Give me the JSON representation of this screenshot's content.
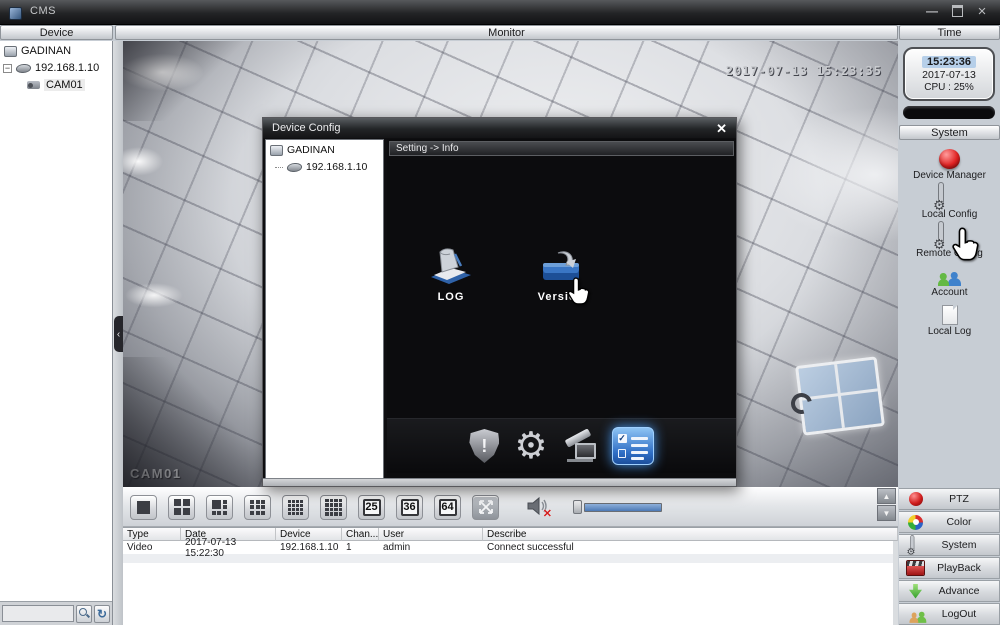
{
  "window": {
    "title": "CMS"
  },
  "glyphs": {
    "minimize": "—",
    "close": "×",
    "dialog_close": "✕",
    "collapse_left": "‹",
    "tree_collapse": "−",
    "refresh": "↻",
    "scroll_up": "▲",
    "scroll_down": "▼",
    "gear": "⚙",
    "mute_x": "✕",
    "shield_mark": "!"
  },
  "panel_headers": {
    "device": "Device",
    "monitor": "Monitor",
    "time": "Time"
  },
  "device_tree": {
    "group": "GADINAN",
    "device_ip": "192.168.1.10",
    "camera": "CAM01"
  },
  "video": {
    "osd_timestamp": "2017-07-13 15:23:35",
    "camera_label": "CAM01"
  },
  "time_panel": {
    "clock": "15:23:36",
    "date": "2017-07-13",
    "cpu": "CPU : 25%"
  },
  "system_menu": {
    "header": "System",
    "items": [
      {
        "label": "Device Manager",
        "icon": "device-manager-icon"
      },
      {
        "label": "Local Config",
        "icon": "monitor-gear-icon"
      },
      {
        "label": "Remote Config",
        "icon": "monitor-gear-icon"
      },
      {
        "label": "Account",
        "icon": "users-icon"
      },
      {
        "label": "Local Log",
        "icon": "document-icon"
      }
    ]
  },
  "action_menu": {
    "items": [
      {
        "label": "PTZ",
        "icon": "ptz-dome-icon"
      },
      {
        "label": "Color",
        "icon": "color-wheel-icon"
      },
      {
        "label": "System",
        "icon": "monitor-gear-icon"
      },
      {
        "label": "PlayBack",
        "icon": "film-clapper-icon"
      },
      {
        "label": "Advance",
        "icon": "green-down-arrow-icon"
      },
      {
        "label": "LogOut",
        "icon": "users-icon"
      }
    ]
  },
  "dialog": {
    "title": "Device Config",
    "breadcrumb": "Setting -> Info",
    "tree": {
      "group": "GADINAN",
      "device_ip": "192.168.1.10"
    },
    "shortcuts": [
      {
        "label": "LOG",
        "icon": "log-scroll-icon"
      },
      {
        "label": "Version",
        "icon": "version-book-icon"
      }
    ],
    "tab_icons": [
      "shield-alert-icon",
      "gear-icon",
      "system-tools-icon",
      "info-list-icon"
    ],
    "active_tab": "info-list-icon"
  },
  "toolbar": {
    "view_icons": [
      "view-1",
      "view-4",
      "view-6",
      "view-9",
      "view-13",
      "view-16"
    ],
    "grid_numbers": [
      "25",
      "36",
      "64"
    ]
  },
  "log_table": {
    "columns": [
      "Type",
      "Date",
      "Device",
      "Chan...",
      "User",
      "Describe"
    ],
    "rows": [
      [
        "Video",
        "2017-07-13 15:22:30",
        "192.168.1.10",
        "1",
        "admin",
        "Connect successful"
      ]
    ]
  },
  "colors": {
    "accent_blue": "#2e6fc0",
    "alert_red": "#d42020",
    "highlight_glow": "#4aa0ff"
  }
}
